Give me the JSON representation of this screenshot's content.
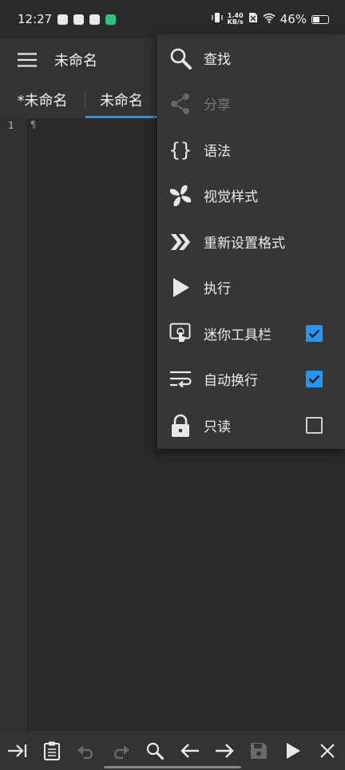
{
  "status_bar": {
    "time": "12:27",
    "net_speed_value": "1.40",
    "net_speed_unit": "KB/s",
    "battery_percent": "46%",
    "battery_level": 0.46
  },
  "app_bar": {
    "title": "未命名",
    "menu_icon": "hamburger-menu-icon"
  },
  "tabs": [
    {
      "label": "*未命名",
      "active": false
    },
    {
      "label": "未命名",
      "active": true
    }
  ],
  "editor": {
    "line_numbers": [
      "1"
    ],
    "content_marker": "¶"
  },
  "overflow_menu": {
    "items": [
      {
        "label": "查找",
        "icon": "search-icon",
        "enabled": true
      },
      {
        "label": "分享",
        "icon": "share-icon",
        "enabled": false
      },
      {
        "label": "语法",
        "icon": "braces-icon",
        "enabled": true
      },
      {
        "label": "视觉样式",
        "icon": "pinwheel-icon",
        "enabled": true
      },
      {
        "label": "重新设置格式",
        "icon": "double-chevron-icon",
        "enabled": true
      },
      {
        "label": "执行",
        "icon": "play-icon",
        "enabled": true
      },
      {
        "label": "迷你工具栏",
        "icon": "touch-screen-icon",
        "enabled": true,
        "checked": true
      },
      {
        "label": "自动换行",
        "icon": "word-wrap-icon",
        "enabled": true,
        "checked": true
      },
      {
        "label": "只读",
        "icon": "lock-icon",
        "enabled": true,
        "checked": false
      }
    ]
  },
  "bottom_toolbar": {
    "buttons": [
      "tab-indent-icon",
      "clipboard-icon",
      "undo-icon",
      "redo-icon",
      "search-icon",
      "arrow-left-icon",
      "arrow-right-icon",
      "save-icon",
      "run-icon",
      "close-icon"
    ]
  },
  "colors": {
    "accent": "#2196f3",
    "background": "#2b2929",
    "toolbar": "#333333",
    "menu": "#363636"
  }
}
